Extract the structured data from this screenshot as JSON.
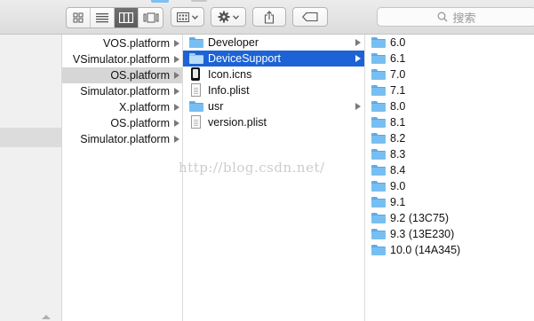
{
  "toolbar": {
    "view_buttons": [
      "icon-view",
      "list-view",
      "column-view",
      "cover-flow-view"
    ],
    "active_view": "column-view",
    "search": {
      "placeholder": "搜索",
      "icon": "magnifier-icon"
    }
  },
  "column1": {
    "items": [
      {
        "label": "VOS.platform"
      },
      {
        "label": "VSimulator.platform"
      },
      {
        "label": "OS.platform"
      },
      {
        "label": "Simulator.platform"
      },
      {
        "label": "X.platform"
      },
      {
        "label": "OS.platform"
      },
      {
        "label": "Simulator.platform"
      }
    ],
    "selected_index": 2
  },
  "column2": {
    "items": [
      {
        "label": "Developer",
        "icon": "folder"
      },
      {
        "label": "DeviceSupport",
        "icon": "folder"
      },
      {
        "label": "Icon.icns",
        "icon": "icns-file"
      },
      {
        "label": "Info.plist",
        "icon": "plist-file"
      },
      {
        "label": "usr",
        "icon": "folder"
      },
      {
        "label": "version.plist",
        "icon": "plist-file"
      }
    ],
    "selected_index": 1
  },
  "column3": {
    "items": [
      {
        "label": "6.0"
      },
      {
        "label": "6.1"
      },
      {
        "label": "7.0"
      },
      {
        "label": "7.1"
      },
      {
        "label": "8.0"
      },
      {
        "label": "8.1"
      },
      {
        "label": "8.2"
      },
      {
        "label": "8.3"
      },
      {
        "label": "8.4"
      },
      {
        "label": "9.0"
      },
      {
        "label": "9.1"
      },
      {
        "label": "9.2 (13C75)"
      },
      {
        "label": "9.3 (13E230)"
      },
      {
        "label": "10.0 (14A345)"
      }
    ]
  },
  "watermark": "http://blog.csdn.net/",
  "colors": {
    "selection_blue": "#1d63d6",
    "selection_gray": "#d6d6d6",
    "folder_blue": "#77bff2"
  }
}
